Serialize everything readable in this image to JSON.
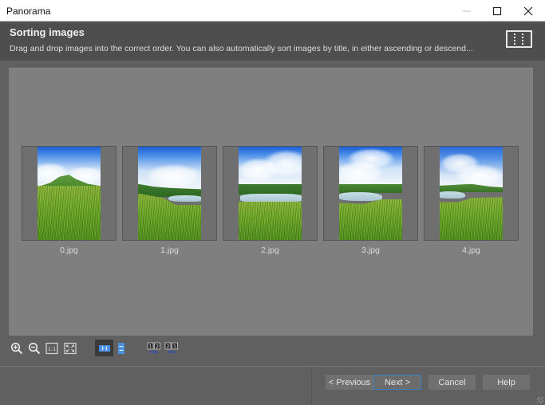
{
  "window": {
    "title": "Panorama",
    "controls": {
      "minimize": "—",
      "maximize": "☐",
      "close": "✕"
    }
  },
  "header": {
    "title": "Sorting images",
    "description": "Drag and drop images into the correct order. You can also automatically sort images by title, in either ascending or descend...",
    "icon": "panorama-strip-icon"
  },
  "images": [
    {
      "filename": "0.jpg",
      "scene": "meadow-hill"
    },
    {
      "filename": "1.jpg",
      "scene": "meadow-lake-right"
    },
    {
      "filename": "2.jpg",
      "scene": "lake-center"
    },
    {
      "filename": "3.jpg",
      "scene": "lake-left"
    },
    {
      "filename": "4.jpg",
      "scene": "lake-far-left"
    }
  ],
  "toolbar": {
    "buttons": [
      {
        "name": "zoom-in",
        "icon": "zoom-in-icon"
      },
      {
        "name": "zoom-out",
        "icon": "zoom-out-icon"
      },
      {
        "name": "actual-size",
        "icon": "actual-size-icon",
        "label": "1:1"
      },
      {
        "name": "fit-to-window",
        "icon": "fit-window-icon"
      },
      {
        "name": "horizontal-layout",
        "icon": "horizontal-layout-icon",
        "active": true
      },
      {
        "name": "vertical-layout",
        "icon": "vertical-layout-icon",
        "active": false
      },
      {
        "name": "sort-ascending",
        "icon": "sort-ascending-icon",
        "label": "1 2"
      },
      {
        "name": "sort-descending",
        "icon": "sort-descending-icon",
        "label": "2 1"
      }
    ]
  },
  "footer": {
    "previous_label": "< Previous",
    "next_label": "Next >",
    "cancel_label": "Cancel",
    "help_label": "Help"
  },
  "colors": {
    "accent": "#3c7fc2",
    "sort_arrow": "#2a52c8",
    "layout_icon": "#4a90e2"
  }
}
